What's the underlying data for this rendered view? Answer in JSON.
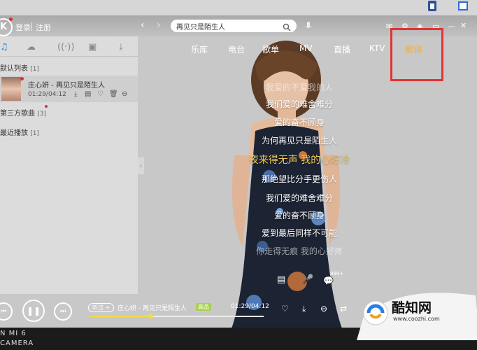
{
  "header": {
    "logo_letter": "K",
    "login": "登录",
    "register": "注册",
    "search_value": "再见只是陌生人"
  },
  "nav": {
    "tabs": [
      "乐库",
      "电台",
      "歌单",
      "MV",
      "直播",
      "KTV",
      "歌词"
    ],
    "active_index": 6
  },
  "sidebar": {
    "lists": [
      {
        "title": "默认列表",
        "count": "[1]"
      },
      {
        "title": "第三方歌曲",
        "count": "[3]"
      },
      {
        "title": "最近播放",
        "count": "[1]"
      }
    ],
    "song": {
      "title": "庄心妍 - 再见只是陌生人",
      "time": "01:29/04:12"
    }
  },
  "lyrics": [
    {
      "text": "我爱的不爱我的人",
      "state": "dim"
    },
    {
      "text": "我们爱的难舍难分",
      "state": "normal"
    },
    {
      "text": "爱的奋不顾身",
      "state": "normal"
    },
    {
      "text": "为何再见只是陌生人",
      "state": "normal"
    },
    {
      "text": "夜来得无声  我的心好冷",
      "state": "current"
    },
    {
      "text": "那绝望比分手更伤人",
      "state": "normal"
    },
    {
      "text": "我们爱的难舍难分",
      "state": "normal"
    },
    {
      "text": "爱的奋不顾身",
      "state": "normal"
    },
    {
      "text": "爱到最后同样不可能",
      "state": "normal"
    },
    {
      "text": "你走得无痕  我的心好疼",
      "state": "dim"
    }
  ],
  "player": {
    "fav_label": "听过 +",
    "now_playing": "庄心妍 - 再见只是陌生人",
    "quality": "高品",
    "time": "01:29/04:12",
    "progress": 0.35,
    "comment_count": "999+"
  },
  "taskbar": {
    "line1": "N MI 6",
    "line2": "CAMERA"
  },
  "watermark": {
    "name": "酷知网",
    "url": "www.coozhi.com"
  },
  "colors": {
    "accent": "#f3b02b",
    "highlight_box": "#e33232",
    "progress": "#f3d94d",
    "active_icon": "#2a8ee8"
  }
}
